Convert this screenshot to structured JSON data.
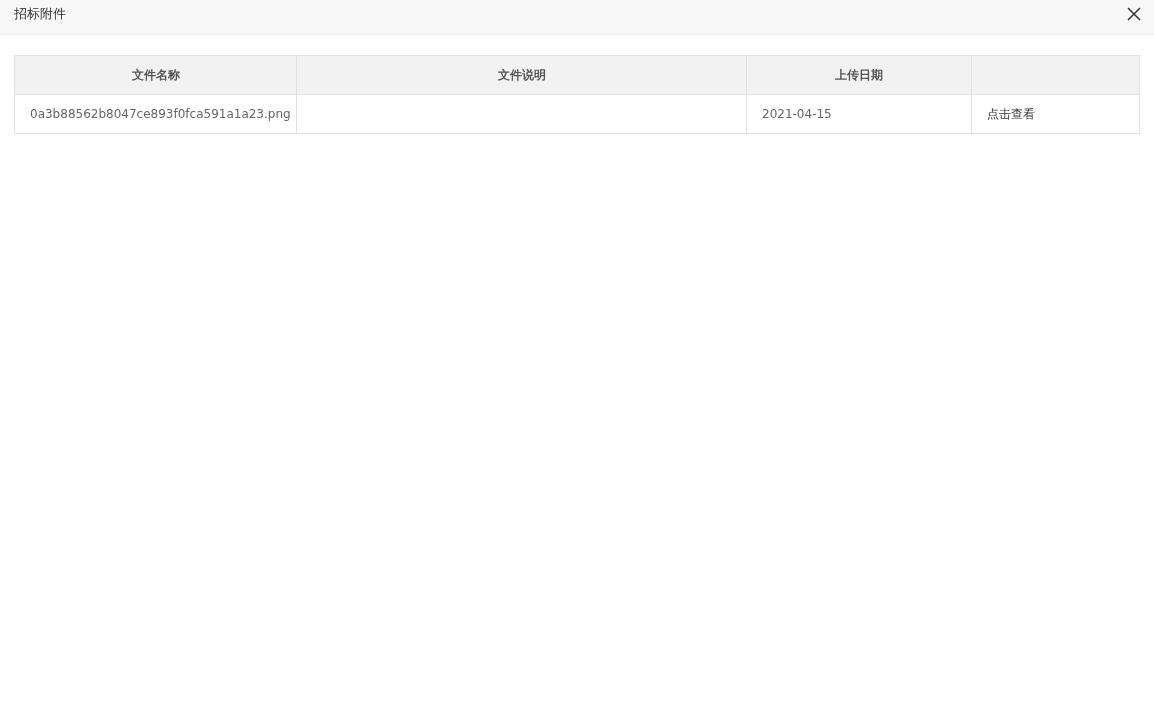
{
  "dialog": {
    "title": "招标附件"
  },
  "table": {
    "columns": [
      "文件名称",
      "文件说明",
      "上传日期"
    ],
    "rows": [
      {
        "file_name": "0a3b88562b8047ce893f0fca591a1a23.png",
        "upload_date": "2021-04-15",
        "action": "点击查看"
      }
    ]
  }
}
